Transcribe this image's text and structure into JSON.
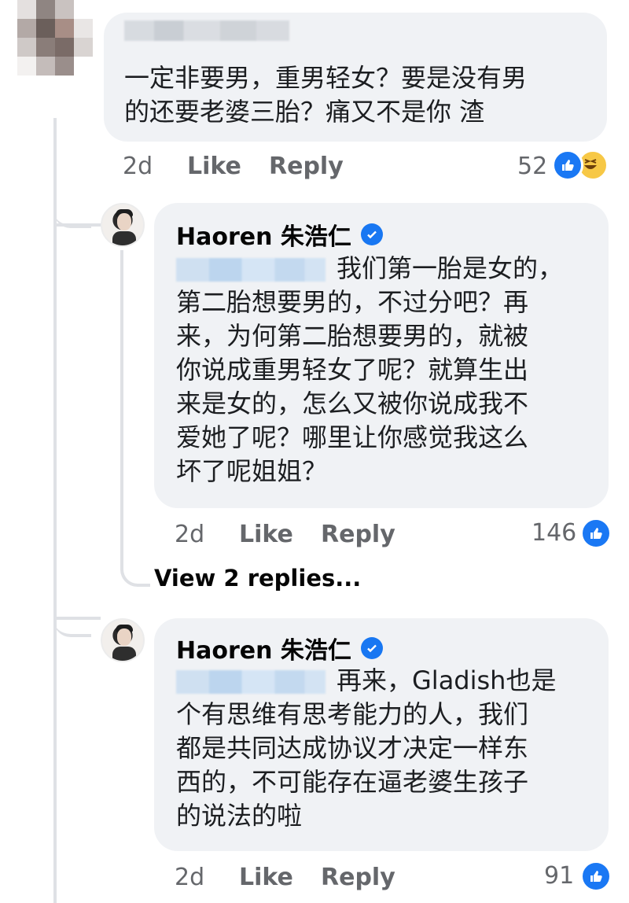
{
  "thread": {
    "top_comment": {
      "text_line1": "一定非要男，重男轻女？要是没有男",
      "text_line2": "的还要老婆三胎？痛又不是你 渣",
      "time": "2d",
      "like_label": "Like",
      "reply_label": "Reply",
      "reaction_count": "52",
      "reactions": [
        "like-icon",
        "haha-icon"
      ]
    },
    "reply1": {
      "author": "Haoren 朱浩仁",
      "verified": true,
      "lines": [
        "我们第一胎是女的，",
        "第二胎想要男的，不过分吧？再",
        "来，为何第二胎想要男的，就被",
        "你说成重男轻女了呢？就算生出",
        "来是女的，怎么又被你说成我不",
        "爱她了呢？哪里让你感觉我这么",
        "坏了呢姐姐？"
      ],
      "time": "2d",
      "like_label": "Like",
      "reply_label": "Reply",
      "reaction_count": "146",
      "view_replies": "View 2 replies..."
    },
    "reply2": {
      "author": "Haoren 朱浩仁",
      "verified": true,
      "lines": [
        "再来，Gladish也是",
        "个有思维有思考能力的人，我们",
        "都是共同达成协议才决定一样东",
        "西的，不可能存在逼老婆生孩子",
        "的说法的啦"
      ],
      "time": "2d",
      "like_label": "Like",
      "reply_label": "Reply",
      "reaction_count": "91"
    }
  },
  "colors": {
    "bubble": "#f0f2f5",
    "secondary_text": "#65676b",
    "facebook_blue": "#1877f2",
    "haha_yellow": "#f7c846",
    "thread_line": "#dfe1e5"
  }
}
